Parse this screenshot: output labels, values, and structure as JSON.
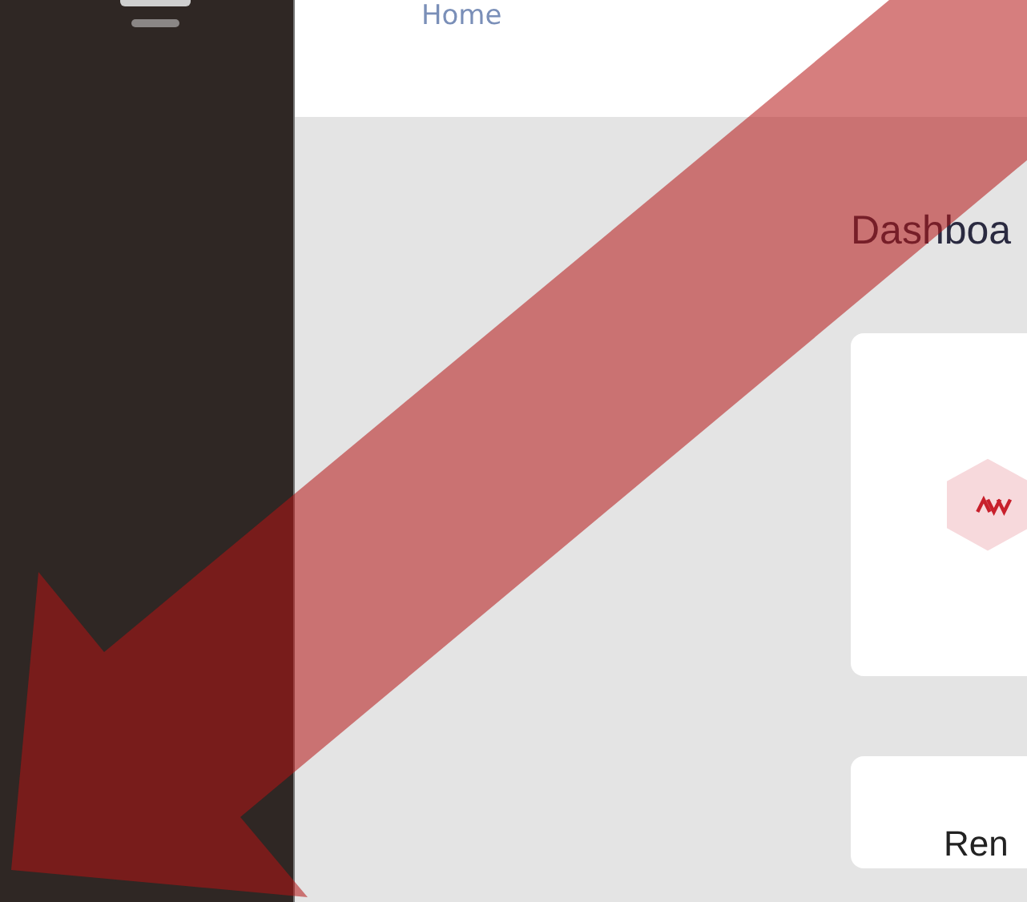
{
  "header": {
    "breadcrumb": "Home"
  },
  "main": {
    "title": "Dashboa",
    "cards": [
      {
        "kind": "logo"
      },
      {
        "kind": "text",
        "title": "Ren"
      }
    ]
  }
}
